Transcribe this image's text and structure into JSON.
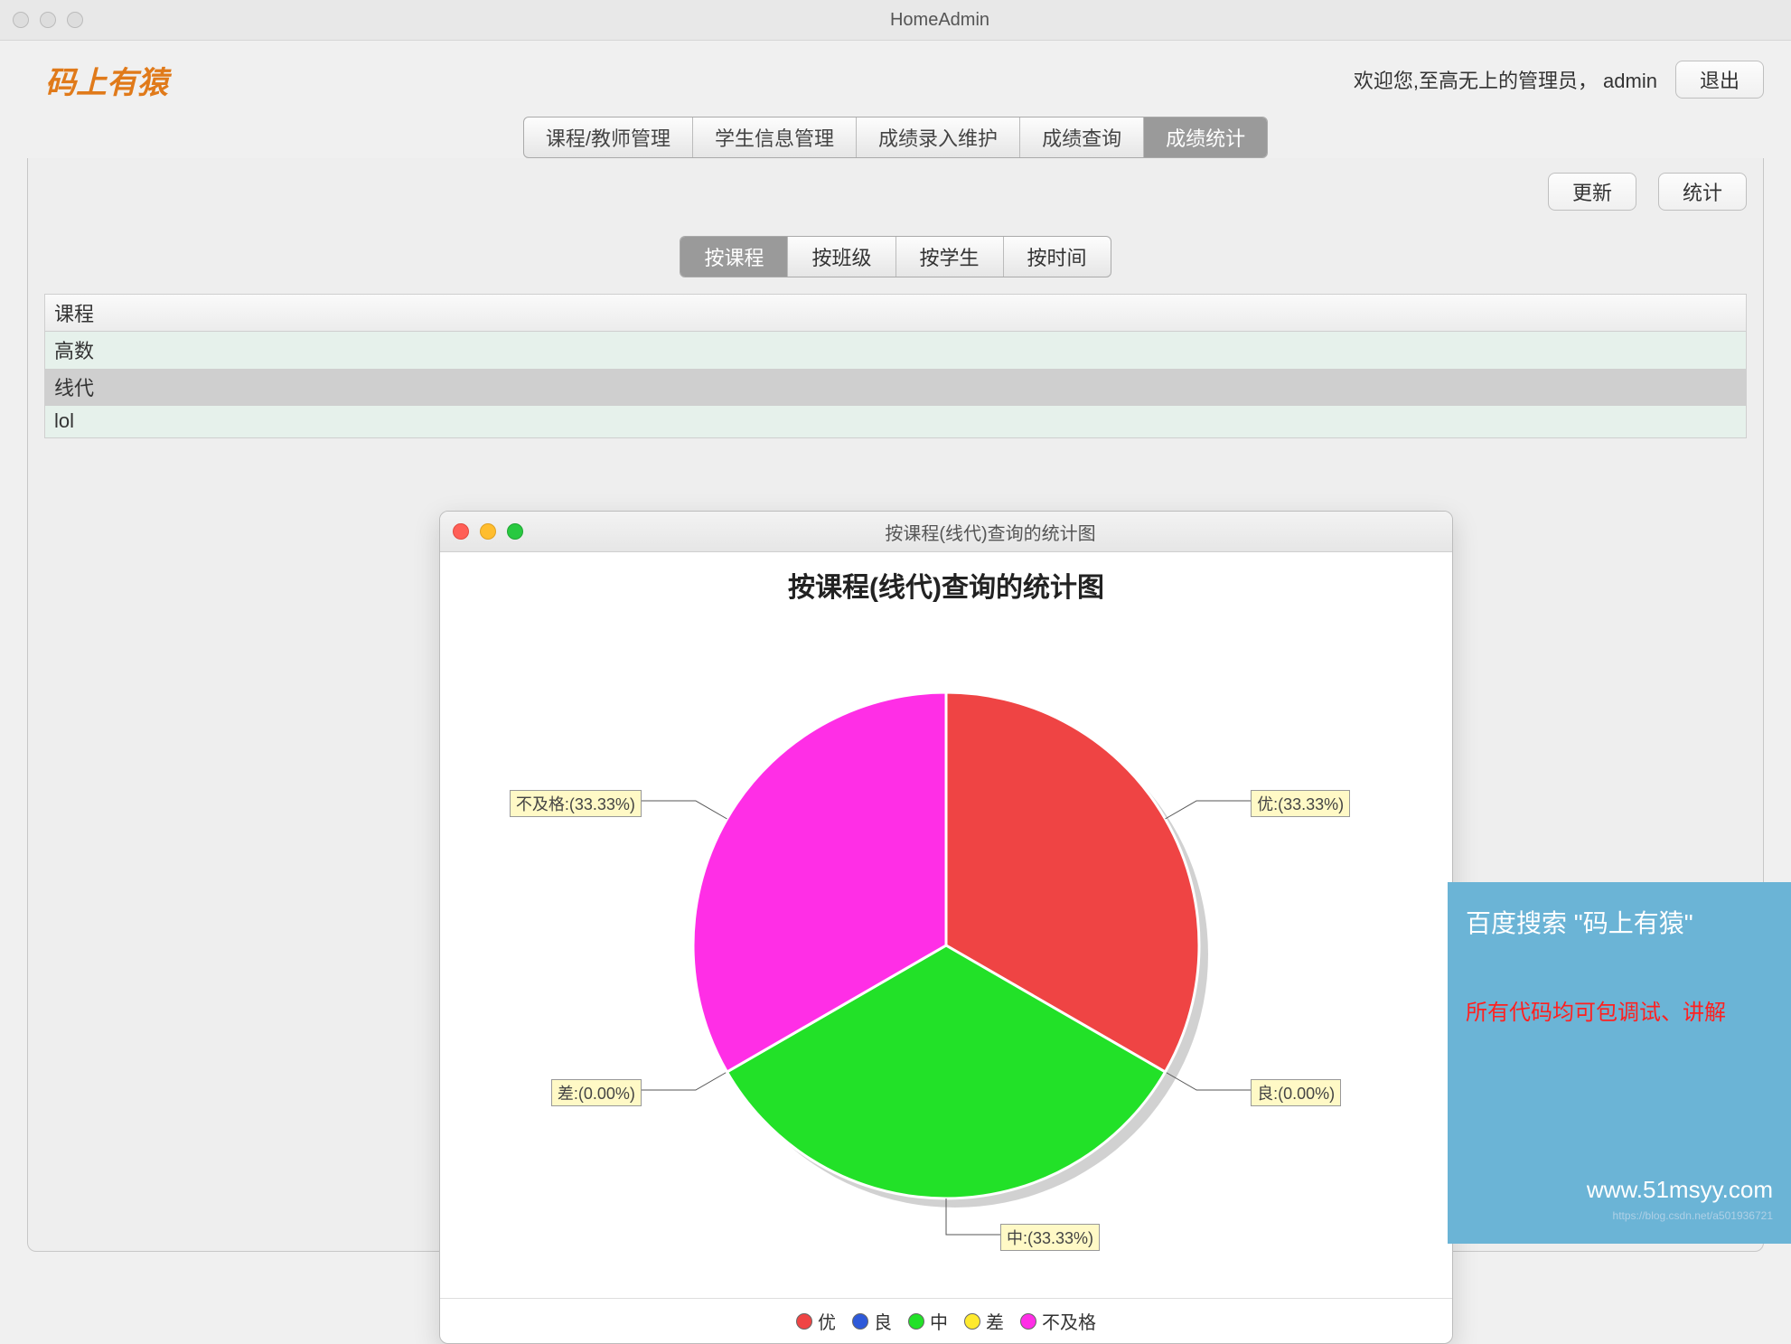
{
  "window": {
    "title": "HomeAdmin"
  },
  "header": {
    "logo_text": "码上有猿",
    "welcome_text": "欢迎您,至高无上的管理员， admin",
    "logout_label": "退出"
  },
  "main_tabs": [
    {
      "label": "课程/教师管理",
      "active": false
    },
    {
      "label": "学生信息管理",
      "active": false
    },
    {
      "label": "成绩录入维护",
      "active": false
    },
    {
      "label": "成绩查询",
      "active": false
    },
    {
      "label": "成绩统计",
      "active": true
    }
  ],
  "actions": {
    "refresh_label": "更新",
    "stats_label": "统计"
  },
  "sub_tabs": [
    {
      "label": "按课程",
      "active": true
    },
    {
      "label": "按班级",
      "active": false
    },
    {
      "label": "按学生",
      "active": false
    },
    {
      "label": "按时间",
      "active": false
    }
  ],
  "table": {
    "header": "课程",
    "rows": [
      {
        "label": "高数",
        "selected": false
      },
      {
        "label": "线代",
        "selected": true
      },
      {
        "label": "lol",
        "selected": false
      }
    ]
  },
  "chart_window": {
    "title": "按课程(线代)查询的统计图",
    "chart_title": "按课程(线代)查询的统计图"
  },
  "chart_data": {
    "type": "pie",
    "title": "按课程(线代)查询的统计图",
    "series": [
      {
        "name": "优",
        "value": 33.33,
        "label": "优:(33.33%)",
        "color": "#ef4444"
      },
      {
        "name": "良",
        "value": 0.0,
        "label": "良:(0.00%)",
        "color": "#2e59d9"
      },
      {
        "name": "中",
        "value": 33.33,
        "label": "中:(33.33%)",
        "color": "#22e128"
      },
      {
        "name": "差",
        "value": 0.0,
        "label": "差:(0.00%)",
        "color": "#ffea2e"
      },
      {
        "name": "不及格",
        "value": 33.33,
        "label": "不及格:(33.33%)",
        "color": "#ff2ee6"
      }
    ],
    "legend_position": "bottom"
  },
  "promo": {
    "line1": "百度搜索 \"码上有猿\"",
    "line2": "所有代码均可包调试、讲解",
    "line3": "www.51msyy.com",
    "line4": "https://blog.csdn.net/a501936721"
  }
}
